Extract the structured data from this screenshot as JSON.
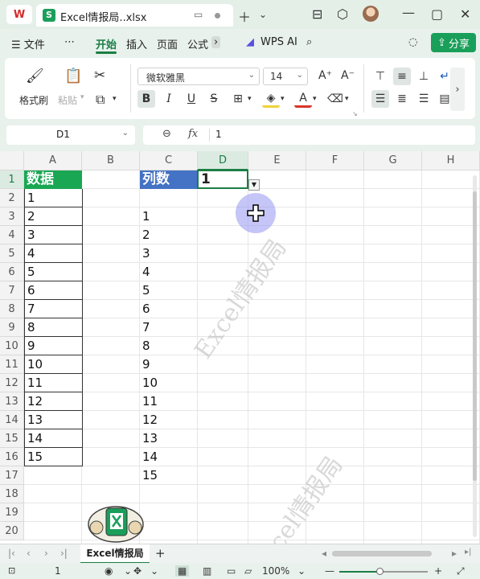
{
  "titlebar": {
    "logo": "W",
    "doc_icon": "S",
    "doc_name": "Excel情报局..xlsx"
  },
  "menu": {
    "items": [
      "☰ 文件",
      "⋯",
      "开始",
      "插入",
      "页面",
      "公式",
      "WPS AI"
    ],
    "share": "分享"
  },
  "ribbon": {
    "format_painter": "格式刷",
    "paste": "粘贴",
    "font_name": "微软雅黑",
    "font_size": "14",
    "bold": "B",
    "italic": "I",
    "underline": "U",
    "strike": "S"
  },
  "formula_bar": {
    "name_box": "D1",
    "fx": "fx",
    "value": "1"
  },
  "columns": [
    "A",
    "B",
    "C",
    "D",
    "E",
    "F",
    "G",
    "H"
  ],
  "rows": [
    "1",
    "2",
    "3",
    "4",
    "5",
    "6",
    "7",
    "8",
    "9",
    "10",
    "11",
    "12",
    "13",
    "14",
    "15",
    "16",
    "17",
    "18",
    "19",
    "20"
  ],
  "sheet": {
    "a_header": "数据",
    "a_values": [
      "1",
      "2",
      "3",
      "4",
      "5",
      "6",
      "7",
      "8",
      "9",
      "10",
      "11",
      "12",
      "13",
      "14",
      "15"
    ],
    "c_header": "列数",
    "d1_value": "1",
    "c_values": [
      "1",
      "2",
      "3",
      "4",
      "5",
      "6",
      "7",
      "8",
      "9",
      "10",
      "11",
      "12",
      "13",
      "14",
      "15"
    ]
  },
  "watermark": "Excel情报局",
  "sheet_tabs": {
    "active": "Excel情报局"
  },
  "status": {
    "cell_value": "1",
    "zoom": "100%"
  },
  "colors": {
    "brand_green": "#1a7e44",
    "header_green": "#1aa754",
    "header_blue": "#4472c4"
  }
}
